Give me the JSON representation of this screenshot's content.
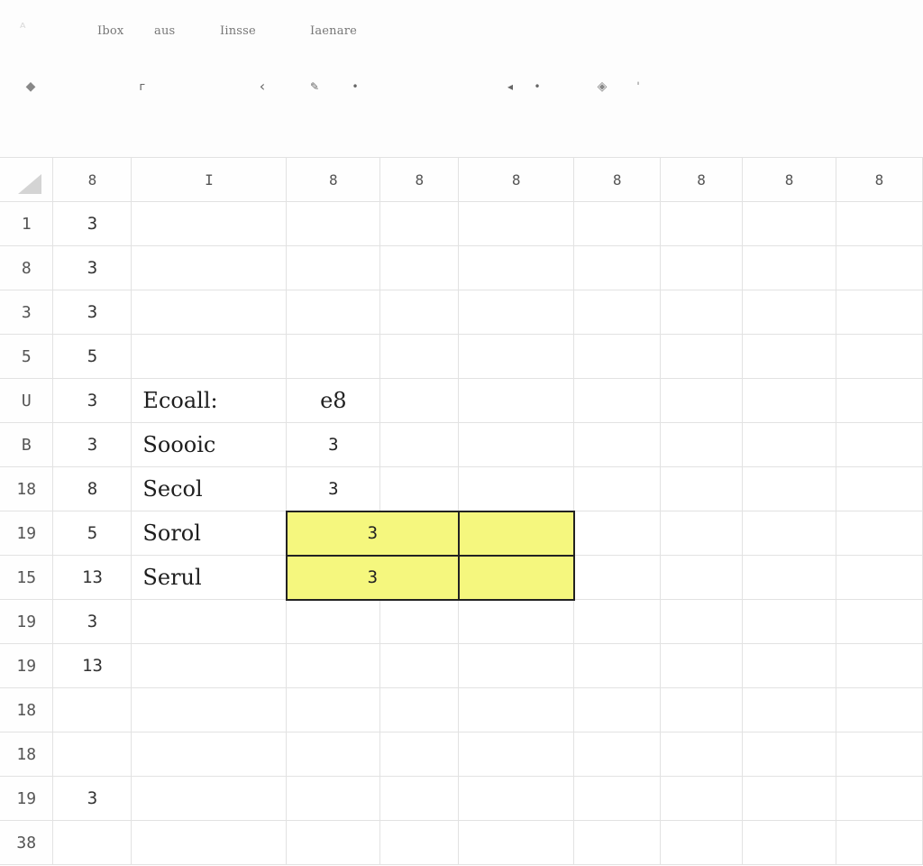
{
  "menu": {
    "items": [
      "Ibox",
      "aus",
      "Iinsse",
      "Iaenare"
    ]
  },
  "toolbar": {
    "tools": [
      {
        "icon": "diamond-small-icon",
        "glyph": "◆"
      },
      {
        "icon": "corner-icon",
        "glyph": "ᴦ"
      },
      {
        "icon": "chevron-left-icon",
        "glyph": "‹"
      },
      {
        "icon": "pen-icon",
        "glyph": "✎"
      },
      {
        "icon": "dot-icon",
        "glyph": "•"
      },
      {
        "icon": "arrow-left-icon",
        "glyph": "◂"
      },
      {
        "icon": "dot-icon",
        "glyph": "•"
      },
      {
        "icon": "fill-icon",
        "glyph": "◈"
      },
      {
        "icon": "small-dot-icon",
        "glyph": "ˈ"
      }
    ]
  },
  "sheet": {
    "column_headers": [
      "8",
      "I",
      "8",
      "8",
      "8",
      "8",
      "8",
      "8",
      "8"
    ],
    "rows": [
      {
        "header": "1",
        "b": "3",
        "c": "",
        "d": "",
        "e": ""
      },
      {
        "header": "8",
        "b": "3",
        "c": "",
        "d": "",
        "e": ""
      },
      {
        "header": "3",
        "b": "3",
        "c": "",
        "d": "",
        "e": ""
      },
      {
        "header": "5",
        "b": "5",
        "c": "",
        "d": "",
        "e": ""
      },
      {
        "header": "U",
        "b": "3",
        "c": "Ecoall:",
        "d": "e8",
        "e": ""
      },
      {
        "header": "B",
        "b": "3",
        "c": "Soooic",
        "d": "3",
        "e": ""
      },
      {
        "header": "18",
        "b": "8",
        "c": "Secol",
        "d": "3",
        "e": ""
      },
      {
        "header": "19",
        "b": "5",
        "c": "Sorol",
        "d": "3",
        "e": ""
      },
      {
        "header": "15",
        "b": "13",
        "c": "Serul",
        "d": "3",
        "e": ""
      },
      {
        "header": "19",
        "b": "3",
        "c": "",
        "d": "",
        "e": ""
      },
      {
        "header": "19",
        "b": "13",
        "c": "",
        "d": "",
        "e": ""
      },
      {
        "header": "18",
        "b": "",
        "c": "",
        "d": "",
        "e": ""
      },
      {
        "header": "18",
        "b": "",
        "c": "",
        "d": "",
        "e": ""
      },
      {
        "header": "19",
        "b": "3",
        "c": "",
        "d": "",
        "e": ""
      },
      {
        "header": "38",
        "b": "",
        "c": "",
        "d": "",
        "e": ""
      }
    ]
  },
  "colors": {
    "highlight": "#f5f77e",
    "grid_line": "#e2e2e2",
    "selection_border": "#222222"
  }
}
